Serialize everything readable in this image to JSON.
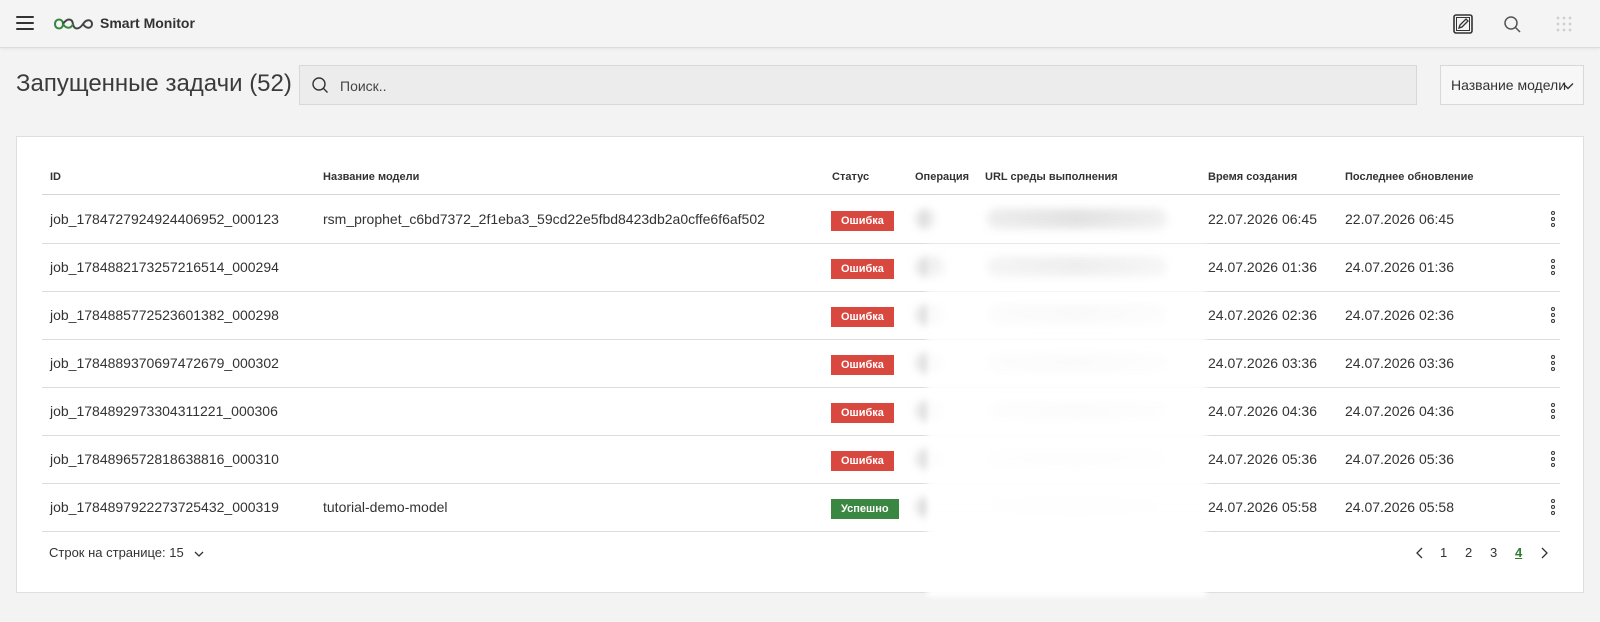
{
  "app": {
    "brand": "Smart Monitor",
    "accent_color": "#2f7d32",
    "icons": [
      "menu-icon",
      "logo-infinity-icon",
      "edit-icon",
      "search-icon",
      "apps-grid-icon"
    ]
  },
  "header": {
    "title": "Запущенные задачи (52)",
    "search_placeholder": "Поиск..",
    "filter_label": "Название модели"
  },
  "table": {
    "columns": [
      "ID",
      "Название модели",
      "Статус",
      "Операция",
      "URL среды выполнения",
      "Время создания",
      "Последнее обновление"
    ],
    "rows": [
      {
        "id": "job_1784727924924406952_000123",
        "model": "rsm_prophet_c6bd7372_2f1eba3_59cd22e5fbd8423db2a0cffe6f6af502",
        "status": "Ошибка",
        "created": "22.07.2026 06:45",
        "updated": "22.07.2026 06:45"
      },
      {
        "id": "job_1784882173257216514_000294",
        "model": "",
        "status": "Ошибка",
        "created": "24.07.2026 01:36",
        "updated": "24.07.2026 01:36"
      },
      {
        "id": "job_1784885772523601382_000298",
        "model": "",
        "status": "Ошибка",
        "created": "24.07.2026 02:36",
        "updated": "24.07.2026 02:36"
      },
      {
        "id": "job_1784889370697472679_000302",
        "model": "",
        "status": "Ошибка",
        "created": "24.07.2026 03:36",
        "updated": "24.07.2026 03:36"
      },
      {
        "id": "job_1784892973304311221_000306",
        "model": "",
        "status": "Ошибка",
        "created": "24.07.2026 04:36",
        "updated": "24.07.2026 04:36"
      },
      {
        "id": "job_1784896572818638816_000310",
        "model": "",
        "status": "Ошибка",
        "created": "24.07.2026 05:36",
        "updated": "24.07.2026 05:36"
      },
      {
        "id": "job_1784897922273725432_000319",
        "model": "tutorial-demo-model",
        "status": "Успешно",
        "created": "24.07.2026 05:58",
        "updated": "24.07.2026 05:58"
      }
    ]
  },
  "footer": {
    "rows_per_page": "Строк на странице: 15",
    "pages": [
      "1",
      "2",
      "3",
      "4"
    ],
    "active_page": "4"
  }
}
